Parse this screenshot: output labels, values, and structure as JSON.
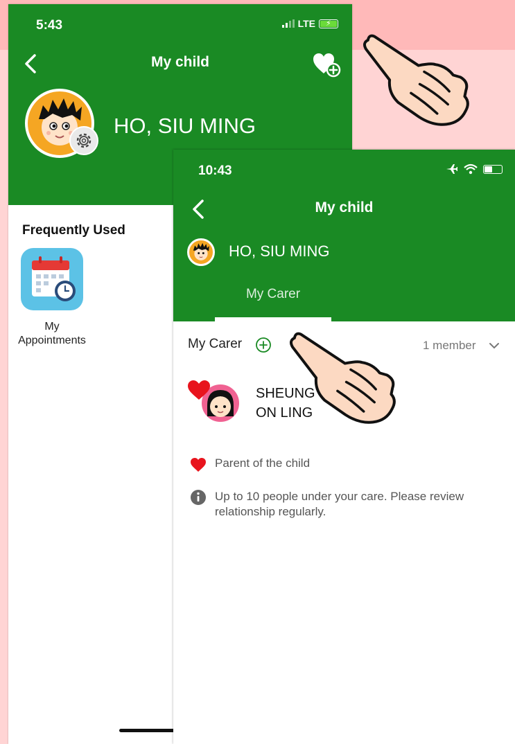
{
  "colors": {
    "header_green": "#1a8a24",
    "heart_red": "#e8141d",
    "bg_pink": "#ffd4d4"
  },
  "back_screen": {
    "status": {
      "time": "5:43",
      "network": "LTE"
    },
    "title": "My child",
    "child_name": "HO, SIU MING",
    "frequently_used_label": "Frequently Used",
    "apps": [
      {
        "label": "My Appointments",
        "icon": "calendar-clock-icon"
      }
    ]
  },
  "front_screen": {
    "status": {
      "time": "10:43"
    },
    "title": "My child",
    "child_name": "HO, SIU MING",
    "tabs": [
      {
        "label": "My Carer",
        "selected": true
      }
    ],
    "carer_section": {
      "title": "My Carer",
      "member_count": "1 member",
      "carers": [
        {
          "name_line1": "SHEUNG",
          "name_line2": "ON LING"
        }
      ]
    },
    "legend_text": "Parent of the child",
    "info_text": "Up to 10 people under your care. Please review relationship regularly."
  }
}
